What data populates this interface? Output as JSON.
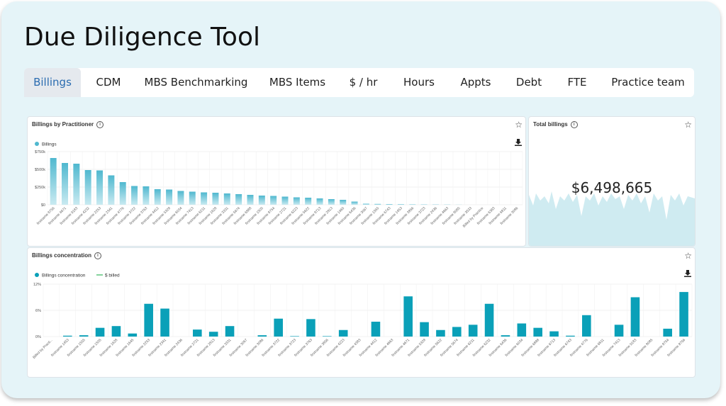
{
  "app": {
    "title": "Due Diligence Tool"
  },
  "tabs": [
    "Billings",
    "CDM",
    "MBS Benchmarking",
    "MBS Items",
    "$ / hr",
    "Hours",
    "Appts",
    "Debt",
    "FTE",
    "Practice team"
  ],
  "active_tab": "Billings",
  "cards": {
    "practitioner": {
      "title": "Billings by Practitioner",
      "info": "i"
    },
    "total": {
      "title": "Total billings",
      "info": "i",
      "value": "$6,498,665"
    },
    "concentration": {
      "title": "Billings concentration",
      "info": "i"
    }
  },
  "icons": {
    "star": "star-outline-icon",
    "download": "download-icon",
    "info": "info-circle-icon"
  },
  "colors": {
    "accent": "#2b6cb0",
    "bar": "#4fb8cf",
    "bar_dark": "#0aa0b8",
    "line": "#5cc47a",
    "bg": "#e5f4f8"
  },
  "chart_data": [
    {
      "type": "bar",
      "legend": [
        "Billings"
      ],
      "ylim": [
        0,
        750000
      ],
      "yticks": [
        "$750k",
        "$500k",
        "$250k",
        "$0"
      ],
      "categories": [
        "firstname 8756",
        "firstname 4671",
        "firstname 9183",
        "firstname 4232",
        "firstname 2253",
        "firstname 2341",
        "firstname 4776",
        "firstname 3722",
        "firstname 3763",
        "firstname 4412",
        "firstname 5328",
        "firstname 6034",
        "firstname 7413",
        "firstname 6211",
        "firstname 1628",
        "firstname 3331",
        "firstname 5674",
        "firstname 6888",
        "firstname 1505",
        "firstname 8754",
        "firstname 2721",
        "firstname 6223",
        "firstname 5622",
        "firstname 8713",
        "firstname 2813",
        "firstname 1465",
        "firstname 6436",
        "firstname 3067",
        "firstname 1555",
        "firstname 6743",
        "firstname 1453",
        "firstname 3856",
        "firstname 3723",
        "firstname 2436",
        "firstname 4663",
        "firstname 8085",
        "firstname 3533",
        "Billed by Practice",
        "firstname 6383",
        "firstname 6811",
        "firstname 3086"
      ],
      "values": [
        660000,
        590000,
        580000,
        490000,
        485000,
        415000,
        320000,
        265000,
        260000,
        220000,
        215000,
        195000,
        185000,
        175000,
        170000,
        160000,
        150000,
        140000,
        130000,
        125000,
        115000,
        105000,
        100000,
        90000,
        80000,
        70000,
        45000,
        15000,
        12000,
        10000,
        8000,
        6000,
        5000,
        3000,
        2000,
        1000,
        0,
        0,
        0,
        0,
        0
      ]
    },
    {
      "type": "bar",
      "legend": [
        "Billings concentration",
        "$ billed"
      ],
      "ylim": [
        0,
        12
      ],
      "yticks": [
        "12%",
        "6%",
        "0%"
      ],
      "categories": [
        "Billed by Practi...",
        "firstname 1453",
        "firstname 1555",
        "firstname 1505",
        "firstname 1628",
        "firstname 1645",
        "firstname 2253",
        "firstname 2341",
        "firstname 2436",
        "firstname 2721",
        "firstname 2813",
        "firstname 3331",
        "firstname 3067",
        "firstname 3086",
        "firstname 3722",
        "firstname 3723",
        "firstname 3763",
        "firstname 3856",
        "firstname 4223",
        "firstname 4383",
        "firstname 4412",
        "firstname 4663",
        "firstname 4671",
        "firstname 5328",
        "firstname 5622",
        "firstname 5674",
        "firstname 6211",
        "firstname 6232",
        "firstname 6436",
        "firstname 6034",
        "firstname 6888",
        "firstname 6713",
        "firstname 6743",
        "firstname 4776",
        "firstname 6811",
        "firstname 7413",
        "firstname 9183",
        "firstname 8085",
        "firstname 8754",
        "firstname 8756"
      ],
      "values": [
        0,
        0.2,
        0.3,
        2.0,
        2.4,
        0.7,
        7.5,
        6.4,
        0,
        1.6,
        1.1,
        2.4,
        0,
        0.3,
        4.1,
        0.1,
        4.0,
        0.1,
        1.5,
        0,
        3.4,
        0,
        9.2,
        3.3,
        1.5,
        2.2,
        2.7,
        7.5,
        0.3,
        3.0,
        2.0,
        1.2,
        0.2,
        4.9,
        0,
        2.7,
        9.0,
        0,
        1.8,
        10.2
      ]
    }
  ]
}
